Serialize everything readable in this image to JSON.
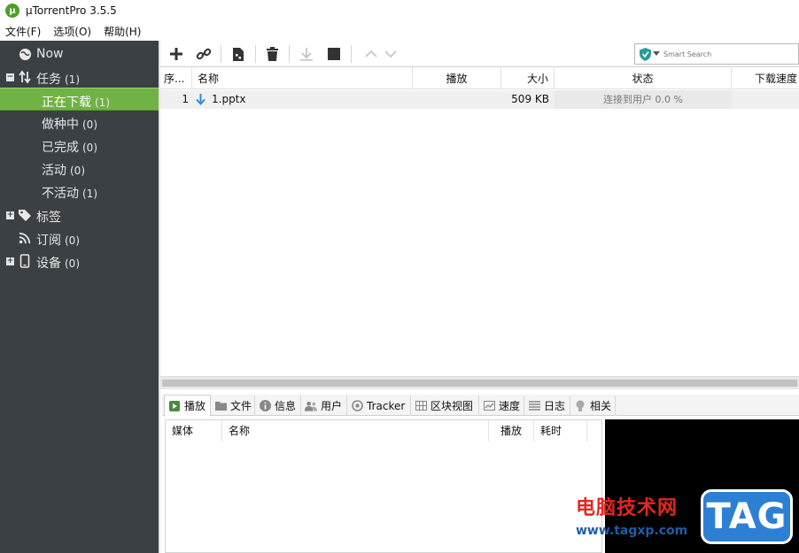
{
  "window": {
    "title": "µTorrentPro 3.5.5",
    "logo_letter": "µ"
  },
  "menu": [
    "文件(F)",
    "选项(O)",
    "帮助(H)"
  ],
  "sidebar": {
    "now": {
      "label": "Now"
    },
    "tasks": {
      "label": "任务",
      "count": "(1)"
    },
    "sub": [
      {
        "label": "正在下载",
        "count": "(1)"
      },
      {
        "label": "做种中",
        "count": "(0)"
      },
      {
        "label": "已完成",
        "count": "(0)"
      },
      {
        "label": "活动",
        "count": "(0)"
      },
      {
        "label": "不活动",
        "count": "(1)"
      }
    ],
    "labels": {
      "label": "标签"
    },
    "feeds": {
      "label": "订阅",
      "count": "(0)"
    },
    "devices": {
      "label": "设备",
      "count": "(0)"
    }
  },
  "toolbar": {
    "search_placeholder": "Smart Search"
  },
  "torrents": {
    "columns": {
      "seq": "序...",
      "name": "名称",
      "play": "播放",
      "size": "大小",
      "status": "状态",
      "download_speed": "下载速度"
    },
    "rows": [
      {
        "seq": "1",
        "name": "1.pptx",
        "size": "509 KB",
        "status": "连接到用户 0.0 %"
      }
    ]
  },
  "tabs": [
    "播放",
    "文件",
    "信息",
    "用户",
    "Tracker",
    "区块视图",
    "速度",
    "日志",
    "相关"
  ],
  "media_list": {
    "columns": {
      "media": "媒体",
      "name": "名称",
      "play": "播放",
      "duration": "耗时"
    }
  },
  "watermark": {
    "cn": "电脑技术网",
    "url": "www.tagxp.com",
    "tag": "TAG"
  },
  "colors": {
    "sidebar_bg": "#3b4045",
    "active_green": "#70b244",
    "arrow_blue": "#2a8fd6"
  }
}
